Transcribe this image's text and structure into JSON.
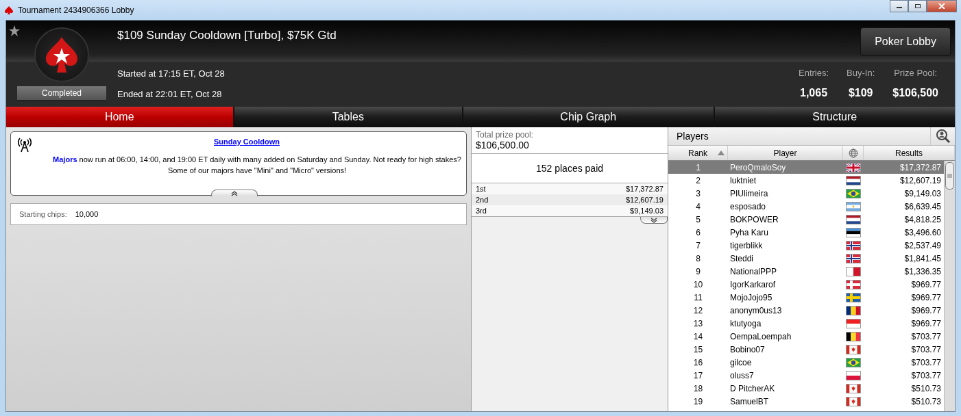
{
  "window": {
    "title": "Tournament 2434906366 Lobby"
  },
  "header": {
    "title": "$109 Sunday Cooldown [Turbo], $75K Gtd",
    "status": "Completed",
    "started": "Started at 17:15 ET, Oct 28",
    "ended": "Ended at 22:01 ET, Oct 28",
    "button": "Poker Lobby",
    "stats": [
      {
        "label": "Entries:",
        "value": "1,065"
      },
      {
        "label": "Buy-In:",
        "value": "$109"
      },
      {
        "label": "Prize Pool:",
        "value": "$106,500"
      }
    ]
  },
  "tabs": [
    {
      "label": "Home",
      "selected": true
    },
    {
      "label": "Tables",
      "selected": false
    },
    {
      "label": "Chip Graph",
      "selected": false
    },
    {
      "label": "Structure",
      "selected": false
    }
  ],
  "notice": {
    "title": "Sunday Cooldown",
    "body": "**Majors** now run at 06:00, 14:00, and 19:00 ET daily with many added on Saturday and Sunday. Not ready for high stakes? Some of our majors have \"Mini\" and \"Micro\" versions!"
  },
  "starting_chips": {
    "label": "Starting chips:",
    "value": "10,000"
  },
  "prizes": {
    "label": "Total prize pool:",
    "total": "$106,500.00",
    "places": "152 places paid",
    "rows": [
      {
        "place": "1st",
        "amount": "$17,372.87"
      },
      {
        "place": "2nd",
        "amount": "$12,607.19"
      },
      {
        "place": "3rd",
        "amount": "$9,149.03"
      }
    ]
  },
  "players": {
    "title": "Players",
    "columns": [
      {
        "label": "Rank",
        "sorted": true
      },
      {
        "label": "Player",
        "sorted": false
      },
      {
        "label": "Results",
        "sorted": false
      }
    ],
    "rows": [
      {
        "rank": "1",
        "name": "PeroQmaloSoy",
        "kind": "gb",
        "result": "$17,372.87",
        "selected": true
      },
      {
        "rank": "2",
        "name": "luktniet",
        "kind": "nl",
        "result": "$12,607.19",
        "selected": false
      },
      {
        "rank": "3",
        "name": "PIUlimeira",
        "kind": "br",
        "result": "$9,149.03",
        "selected": false
      },
      {
        "rank": "4",
        "name": "esposado",
        "kind": "ar",
        "result": "$6,639.45",
        "selected": false
      },
      {
        "rank": "5",
        "name": "BOKPOWER",
        "kind": "nl",
        "result": "$4,818.25",
        "selected": false
      },
      {
        "rank": "6",
        "name": "Pyha Karu",
        "kind": "ee",
        "result": "$3,496.60",
        "selected": false
      },
      {
        "rank": "7",
        "name": "tigerblikk",
        "kind": "no",
        "result": "$2,537.49",
        "selected": false
      },
      {
        "rank": "8",
        "name": "Steddi",
        "kind": "no",
        "result": "$1,841.45",
        "selected": false
      },
      {
        "rank": "9",
        "name": "NationalPPP",
        "kind": "mt",
        "result": "$1,336.35",
        "selected": false
      },
      {
        "rank": "10",
        "name": "IgorKarkarof",
        "kind": "dk",
        "result": "$969.77",
        "selected": false
      },
      {
        "rank": "11",
        "name": "MojoJojo95",
        "kind": "se",
        "result": "$969.77",
        "selected": false
      },
      {
        "rank": "12",
        "name": "anonym0us13",
        "kind": "ro",
        "result": "$969.77",
        "selected": false
      },
      {
        "rank": "13",
        "name": "ktutyoga",
        "kind": "id",
        "result": "$969.77",
        "selected": false
      },
      {
        "rank": "14",
        "name": "OempaLoempah",
        "kind": "be",
        "result": "$703.77",
        "selected": false
      },
      {
        "rank": "15",
        "name": "Bobino07",
        "kind": "ca",
        "result": "$703.77",
        "selected": false
      },
      {
        "rank": "16",
        "name": "gilcoe",
        "kind": "br",
        "result": "$703.77",
        "selected": false
      },
      {
        "rank": "17",
        "name": "oluss7",
        "kind": "pl",
        "result": "$703.77",
        "selected": false
      },
      {
        "rank": "18",
        "name": "D PitcherAK",
        "kind": "ca",
        "result": "$510.73",
        "selected": false
      },
      {
        "rank": "19",
        "name": "SamuelBT",
        "kind": "ca",
        "result": "$510.73",
        "selected": false
      }
    ]
  }
}
